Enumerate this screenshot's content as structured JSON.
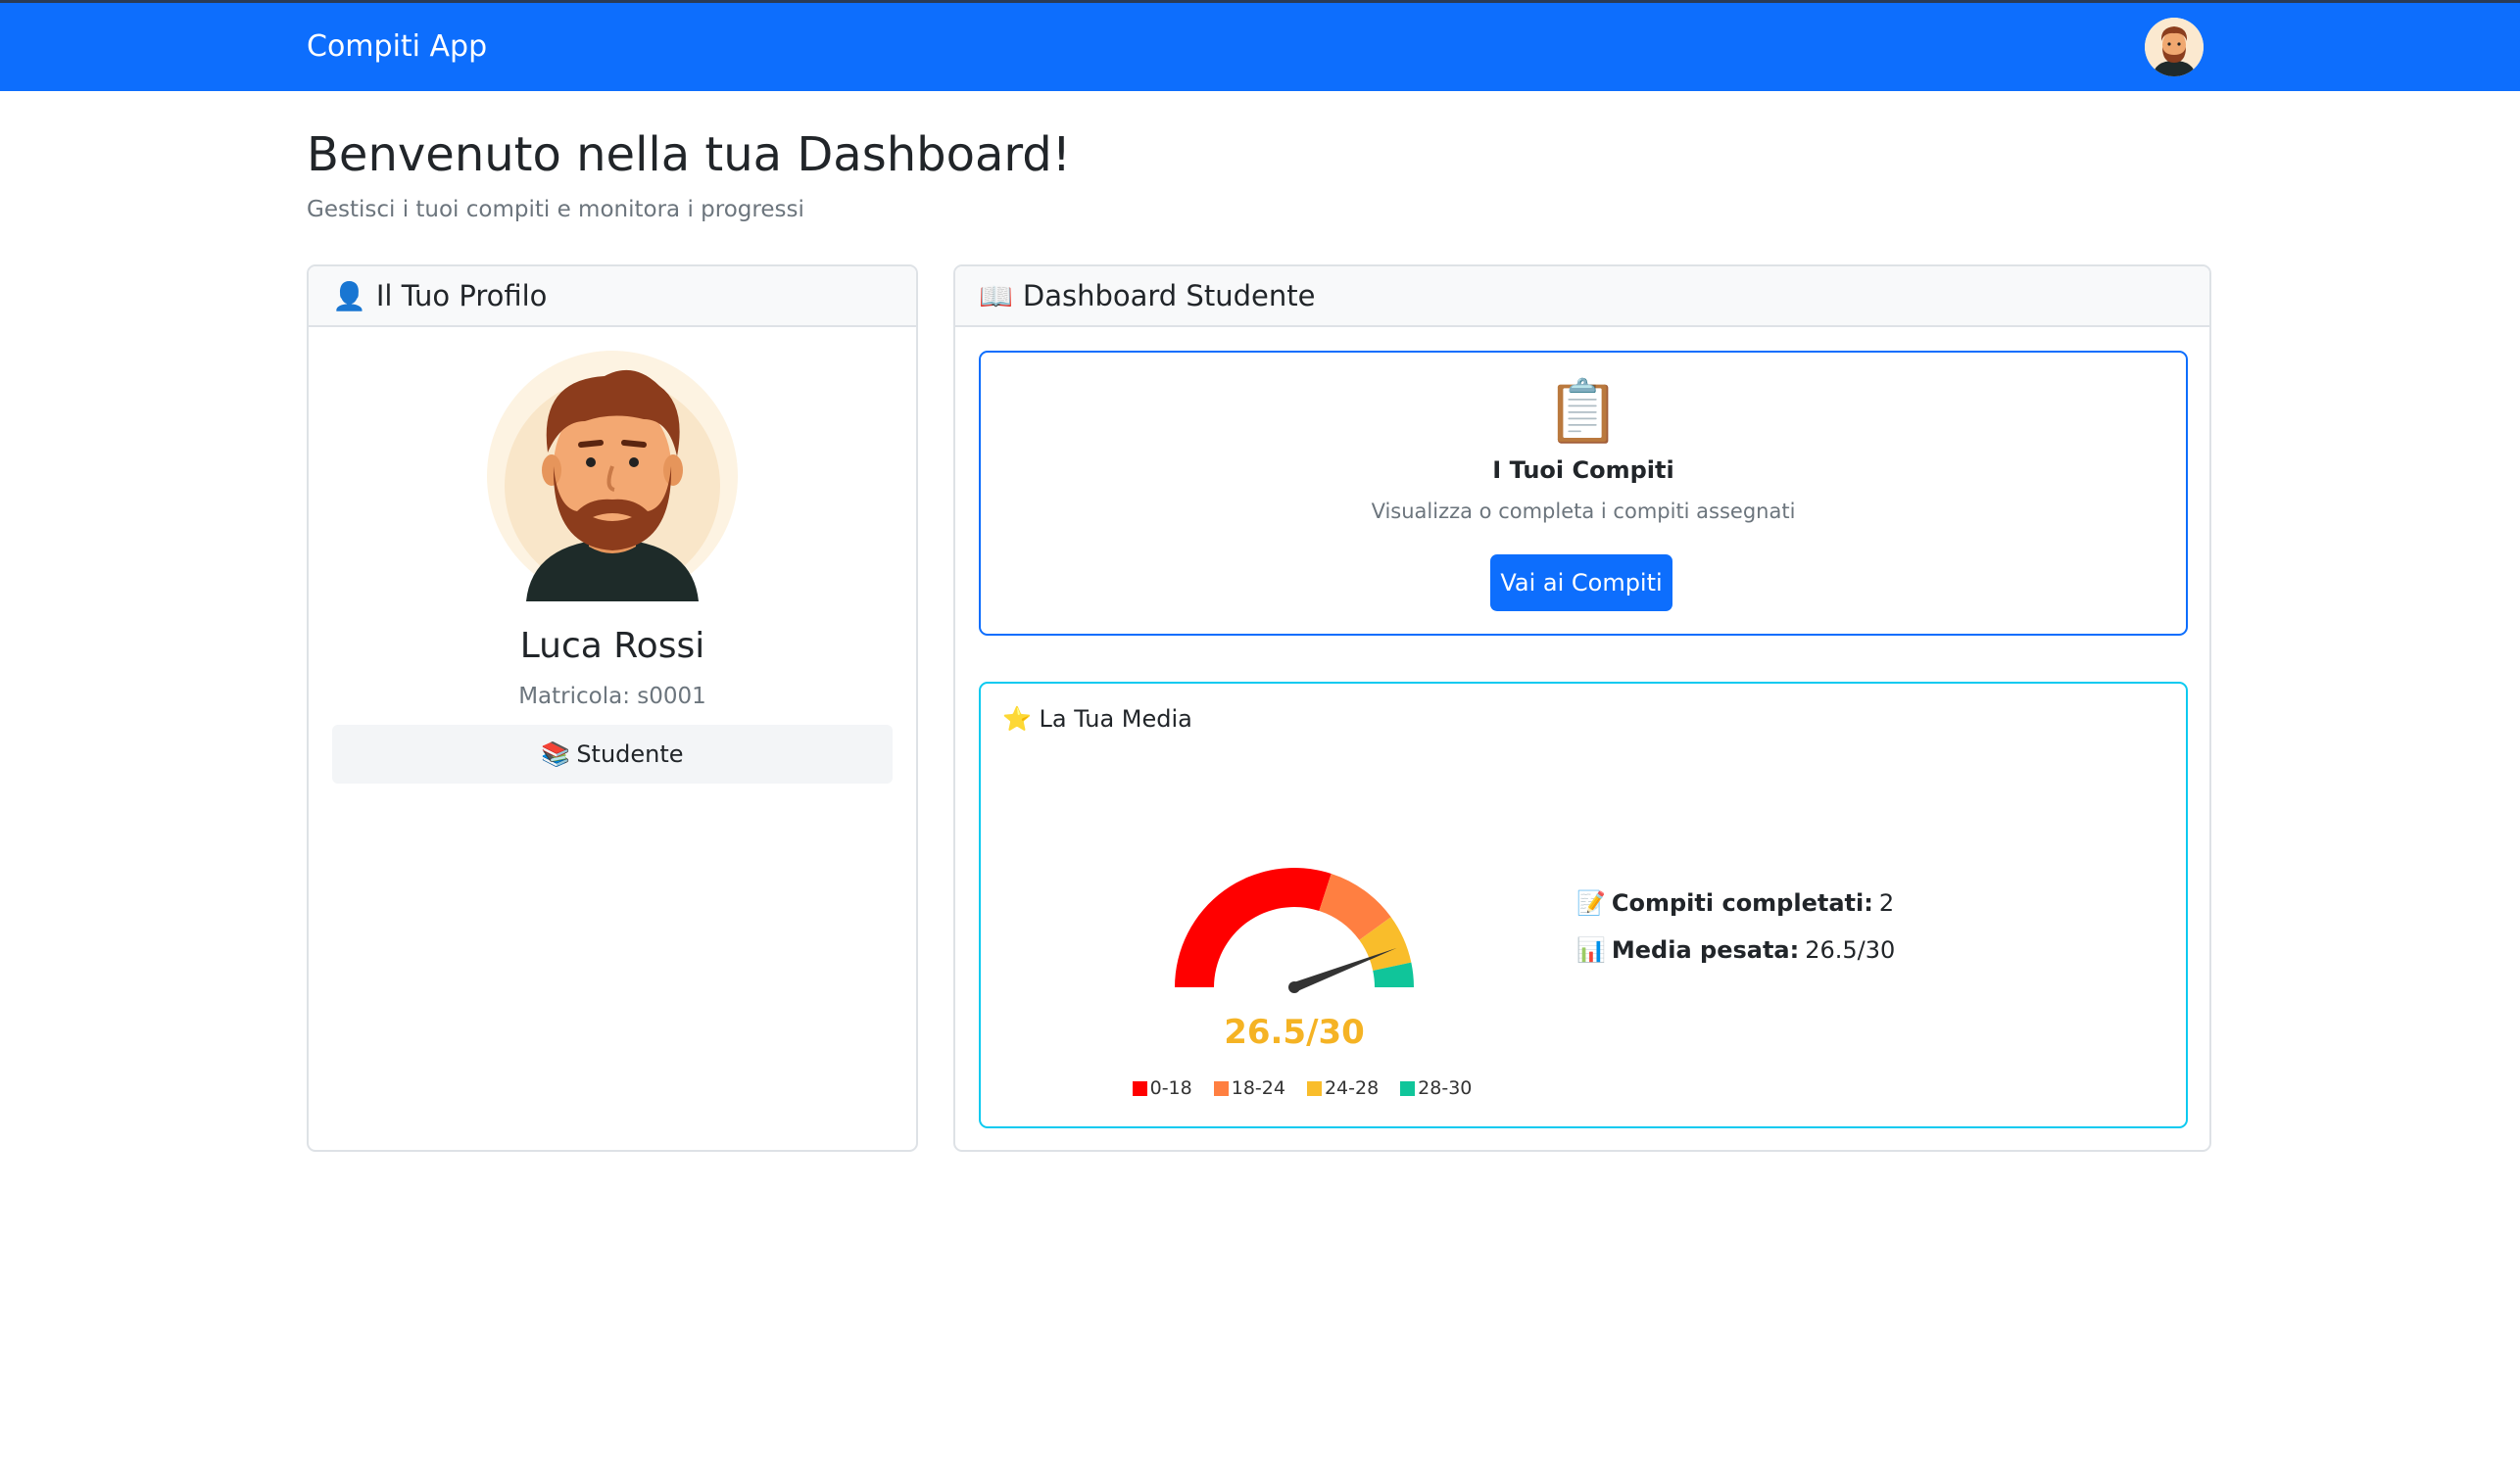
{
  "navbar": {
    "brand": "Compiti App",
    "avatar_icon": "user-avatar-icon"
  },
  "page": {
    "title": "Benvenuto nella tua Dashboard!",
    "subtitle": "Gestisci i tuoi compiti e monitora i progressi"
  },
  "profile": {
    "header_icon": "👤",
    "header": "Il Tuo Profilo",
    "name": "Luca Rossi",
    "matricola": "Matricola: s0001",
    "role_icon": "📚",
    "role": "Studente"
  },
  "dashboard": {
    "header_icon": "📖",
    "header": "Dashboard Studente",
    "tasks": {
      "icon": "📋",
      "title": "I Tuoi Compiti",
      "description": "Visualizza o completa i compiti assegnati",
      "button_label": "Vai ai Compiti"
    },
    "media": {
      "title_icon": "⭐",
      "title": "La Tua Media",
      "gauge_value": 26.5,
      "gauge_max": 30,
      "gauge_label": "26.5/30",
      "gauge_color": "#f5b324",
      "legend": [
        {
          "label": "0-18",
          "color": "#ff0000"
        },
        {
          "label": "18-24",
          "color": "#ff7f41"
        },
        {
          "label": "24-28",
          "color": "#f9bd2b"
        },
        {
          "label": "28-30",
          "color": "#10c59a"
        }
      ],
      "stats": [
        {
          "icon": "📝",
          "label": "Compiti completati:",
          "value": "2"
        },
        {
          "icon": "📊",
          "label": "Media pesata:",
          "value": "26.5/30"
        }
      ]
    }
  },
  "colors": {
    "primary": "#0d6efd",
    "info": "#0dcaf0"
  }
}
